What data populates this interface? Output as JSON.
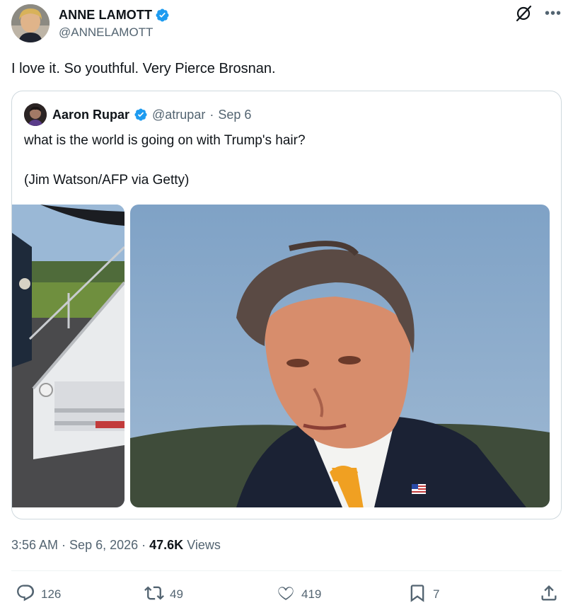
{
  "post": {
    "author_name": "ANNE LAMOTT",
    "author_handle": "@ANNELAMOTT",
    "text": "I love it. So youthful. Very Pierce Brosnan.",
    "more_icon": "more-icon",
    "grok_icon": "grok-icon"
  },
  "quote": {
    "author_name": "Aaron Rupar",
    "author_handle": "@atrupar",
    "separator": "·",
    "date": "Sep 6",
    "text_line1": "what is the world is going on with Trump's hair?",
    "text_line2": "(Jim Watson/AFP via Getty)"
  },
  "meta": {
    "time": "3:56 AM",
    "dot1": "·",
    "date": "Sep 6, 2026",
    "dot2": "·",
    "views_count": "47.6K",
    "views_label": "Views"
  },
  "actions": {
    "replies": "126",
    "reposts": "49",
    "likes": "419",
    "bookmarks": "7"
  },
  "colors": {
    "verified": "#1d9bf0",
    "secondary_text": "#536471",
    "border": "#cfd9de"
  }
}
